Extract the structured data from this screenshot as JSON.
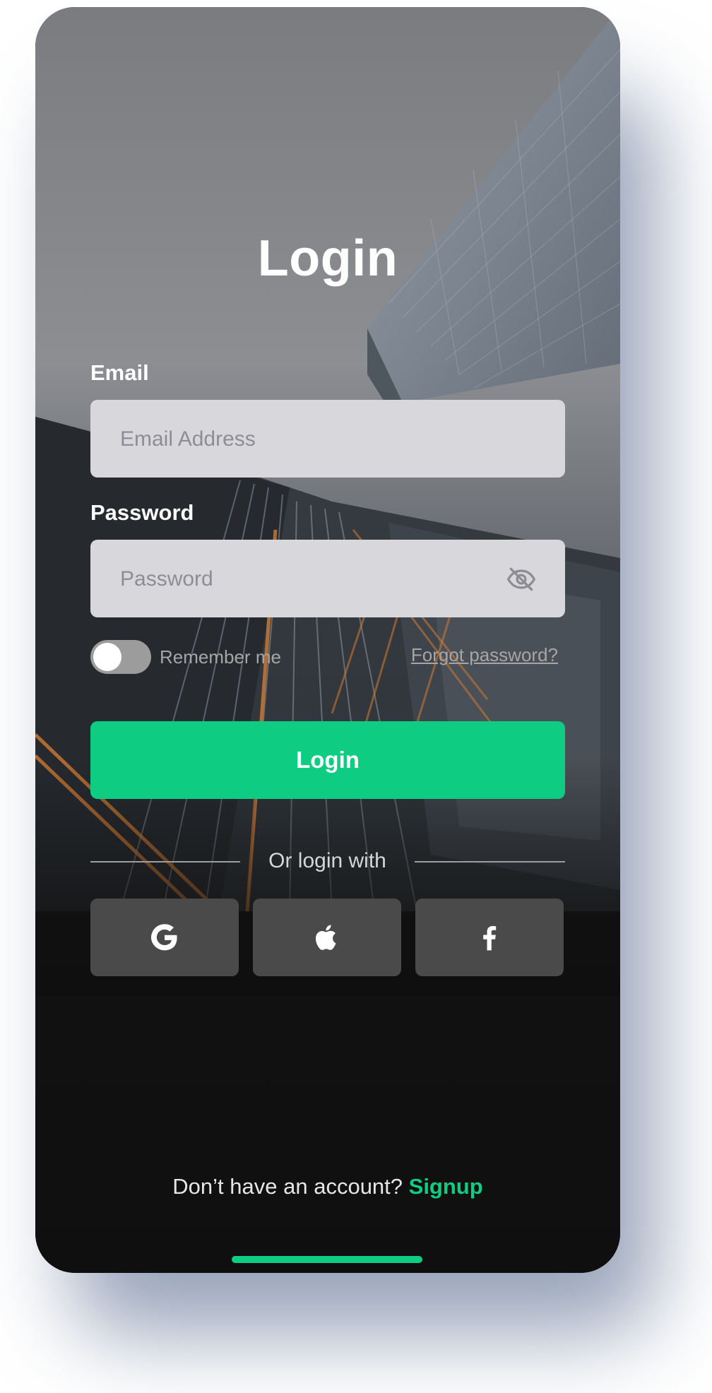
{
  "title": "Login",
  "email": {
    "label": "Email",
    "placeholder": "Email Address",
    "value": ""
  },
  "password": {
    "label": "Password",
    "placeholder": "Password",
    "value": "",
    "toggle_icon": "eye-off-icon"
  },
  "remember": {
    "label": "Remember me",
    "checked": false
  },
  "forgot_label": "Forgot password?",
  "login_button_label": "Login",
  "divider_text": "Or login with",
  "social": [
    {
      "name": "google",
      "icon": "google-icon"
    },
    {
      "name": "apple",
      "icon": "apple-icon"
    },
    {
      "name": "facebook",
      "icon": "facebook-icon"
    }
  ],
  "signup": {
    "prompt": "Don’t have an account?",
    "link": "Signup"
  },
  "colors": {
    "accent": "#0ecd82",
    "input_bg": "#d8d8dc",
    "social_bg": "#4a4a4a",
    "dark_bg": "#0f0f0f"
  }
}
